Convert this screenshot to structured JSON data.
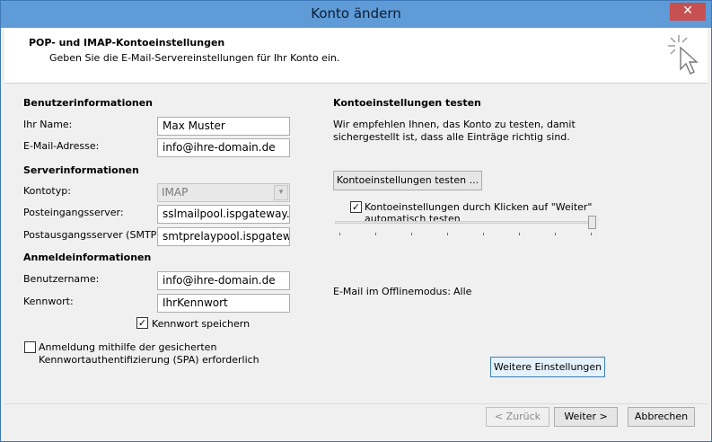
{
  "window": {
    "title": "Konto ändern",
    "close_label": "✕"
  },
  "header": {
    "title": "POP- und IMAP-Kontoeinstellungen",
    "subtitle": "Geben Sie die E-Mail-Servereinstellungen für Ihr Konto ein."
  },
  "user_info": {
    "heading": "Benutzerinformationen",
    "name_label": "Ihr Name:",
    "name_value": "Max Muster",
    "email_label": "E-Mail-Adresse:",
    "email_value": "info@ihre-domain.de"
  },
  "server_info": {
    "heading": "Serverinformationen",
    "type_label": "Kontotyp:",
    "type_value": "IMAP",
    "incoming_label": "Posteingangsserver:",
    "incoming_value": "sslmailpool.ispgateway.de",
    "outgoing_label": "Postausgangsserver (SMTP):",
    "outgoing_value": "smtprelaypool.ispgateway.de"
  },
  "login_info": {
    "heading": "Anmeldeinformationen",
    "user_label": "Benutzername:",
    "user_value": "info@ihre-domain.de",
    "password_label": "Kennwort:",
    "password_value": "IhrKennwort",
    "save_password_label": "Kennwort speichern",
    "save_password_checked": true,
    "spa_label_line1": "Anmeldung mithilfe der gesicherten",
    "spa_label_line2": "Kennwortauthentifizierung (SPA) erforderlich",
    "spa_checked": false
  },
  "test": {
    "heading": "Kontoeinstellungen testen",
    "desc_line1": "Wir empfehlen Ihnen, das Konto zu testen, damit",
    "desc_line2": "sichergestellt ist, dass alle Einträge richtig sind.",
    "test_button": "Kontoeinstellungen testen ...",
    "auto_test_line1": "Kontoeinstellungen durch Klicken auf \"Weiter\"",
    "auto_test_line2": "automatisch testen",
    "auto_test_checked": true
  },
  "offline": {
    "label": "E-Mail im Offlinemodus:",
    "value": "Alle",
    "slider_level": 1.0
  },
  "buttons": {
    "more_settings": "Weitere Einstellungen",
    "back": "< Zurück",
    "next": "Weiter >",
    "cancel": "Abbrechen"
  }
}
